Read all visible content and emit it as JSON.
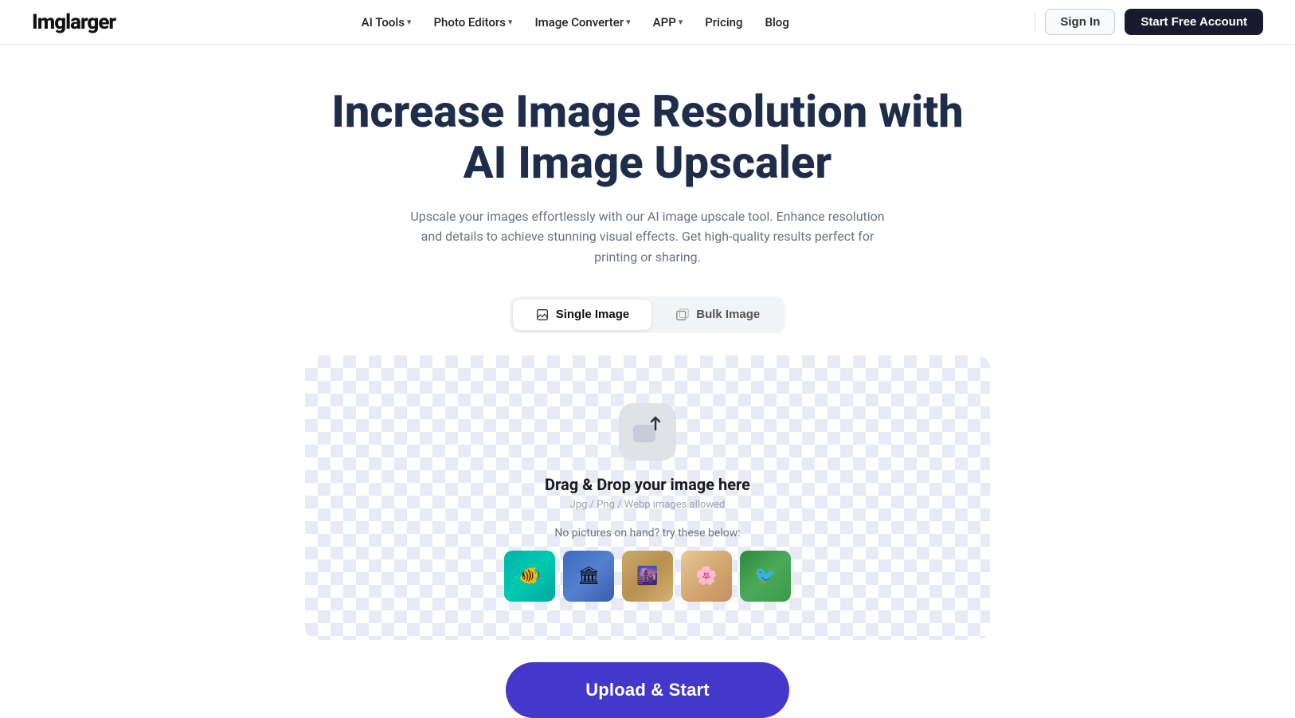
{
  "brand": {
    "logo": "Imglarger"
  },
  "nav": {
    "items": [
      {
        "id": "ai-tools",
        "label": "AI Tools",
        "hasDropdown": true
      },
      {
        "id": "photo-editors",
        "label": "Photo Editors",
        "hasDropdown": true
      },
      {
        "id": "image-converter",
        "label": "Image Converter",
        "hasDropdown": true
      },
      {
        "id": "app",
        "label": "APP",
        "hasDropdown": true
      },
      {
        "id": "pricing",
        "label": "Pricing",
        "hasDropdown": false
      },
      {
        "id": "blog",
        "label": "Blog",
        "hasDropdown": false
      }
    ],
    "signin_label": "Sign In",
    "start_label": "Start Free Account"
  },
  "hero": {
    "title": "Increase Image Resolution with AI Image Upscaler",
    "subtitle": "Upscale your images effortlessly with our AI image upscale tool. Enhance resolution and details to achieve stunning visual effects. Get high-quality results perfect for printing or sharing."
  },
  "tabs": {
    "single_label": "Single Image",
    "bulk_label": "Bulk Image",
    "active": "single"
  },
  "dropzone": {
    "drag_title": "Drag & Drop your image here",
    "formats": "Jpg / Png / Webp images allowed",
    "no_pictures": "No pictures on hand? try these below:",
    "samples": [
      {
        "id": "sample-1",
        "alt": "fish"
      },
      {
        "id": "sample-2",
        "alt": "tower"
      },
      {
        "id": "sample-3",
        "alt": "city"
      },
      {
        "id": "sample-4",
        "alt": "flower"
      },
      {
        "id": "sample-5",
        "alt": "bird"
      }
    ]
  },
  "upload_button": {
    "label": "Upload & Start"
  }
}
